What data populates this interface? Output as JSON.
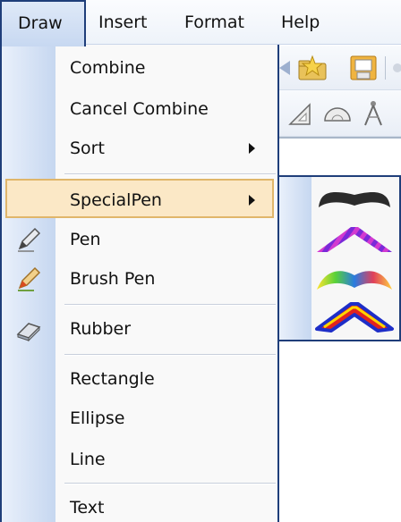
{
  "menubar": {
    "items": [
      {
        "label": "Draw",
        "active": true
      },
      {
        "label": "Insert",
        "active": false
      },
      {
        "label": "Format",
        "active": false
      },
      {
        "label": "Help",
        "active": false
      }
    ]
  },
  "draw_menu": {
    "items": [
      {
        "label": "Combine",
        "icon": null,
        "has_submenu": false
      },
      {
        "label": "Cancel Combine",
        "icon": null,
        "has_submenu": false
      },
      {
        "label": "Sort",
        "icon": null,
        "has_submenu": true
      },
      {
        "label": "SpecialPen",
        "icon": null,
        "has_submenu": true,
        "highlighted": true
      },
      {
        "label": "Pen",
        "icon": "pencil-icon",
        "has_submenu": false
      },
      {
        "label": "Brush Pen",
        "icon": "brush-pen-icon",
        "has_submenu": false
      },
      {
        "label": "Rubber",
        "icon": "eraser-icon",
        "has_submenu": false
      },
      {
        "label": "Rectangle",
        "icon": null,
        "has_submenu": false
      },
      {
        "label": "Ellipse",
        "icon": null,
        "has_submenu": false
      },
      {
        "label": "Line",
        "icon": null,
        "has_submenu": false
      },
      {
        "label": "Text",
        "icon": null,
        "has_submenu": false
      }
    ]
  },
  "special_pen_submenu": {
    "styles": [
      "black-pen-stroke",
      "purple-striped-pen-stroke",
      "rainbow-pen-stroke",
      "red-blue-outlined-pen-stroke"
    ]
  },
  "colors": {
    "menu_border": "#1f3e7a",
    "highlight_fill": "#fbe8c6",
    "highlight_border": "#e0b66a",
    "gutter": "#c6d7f0"
  }
}
